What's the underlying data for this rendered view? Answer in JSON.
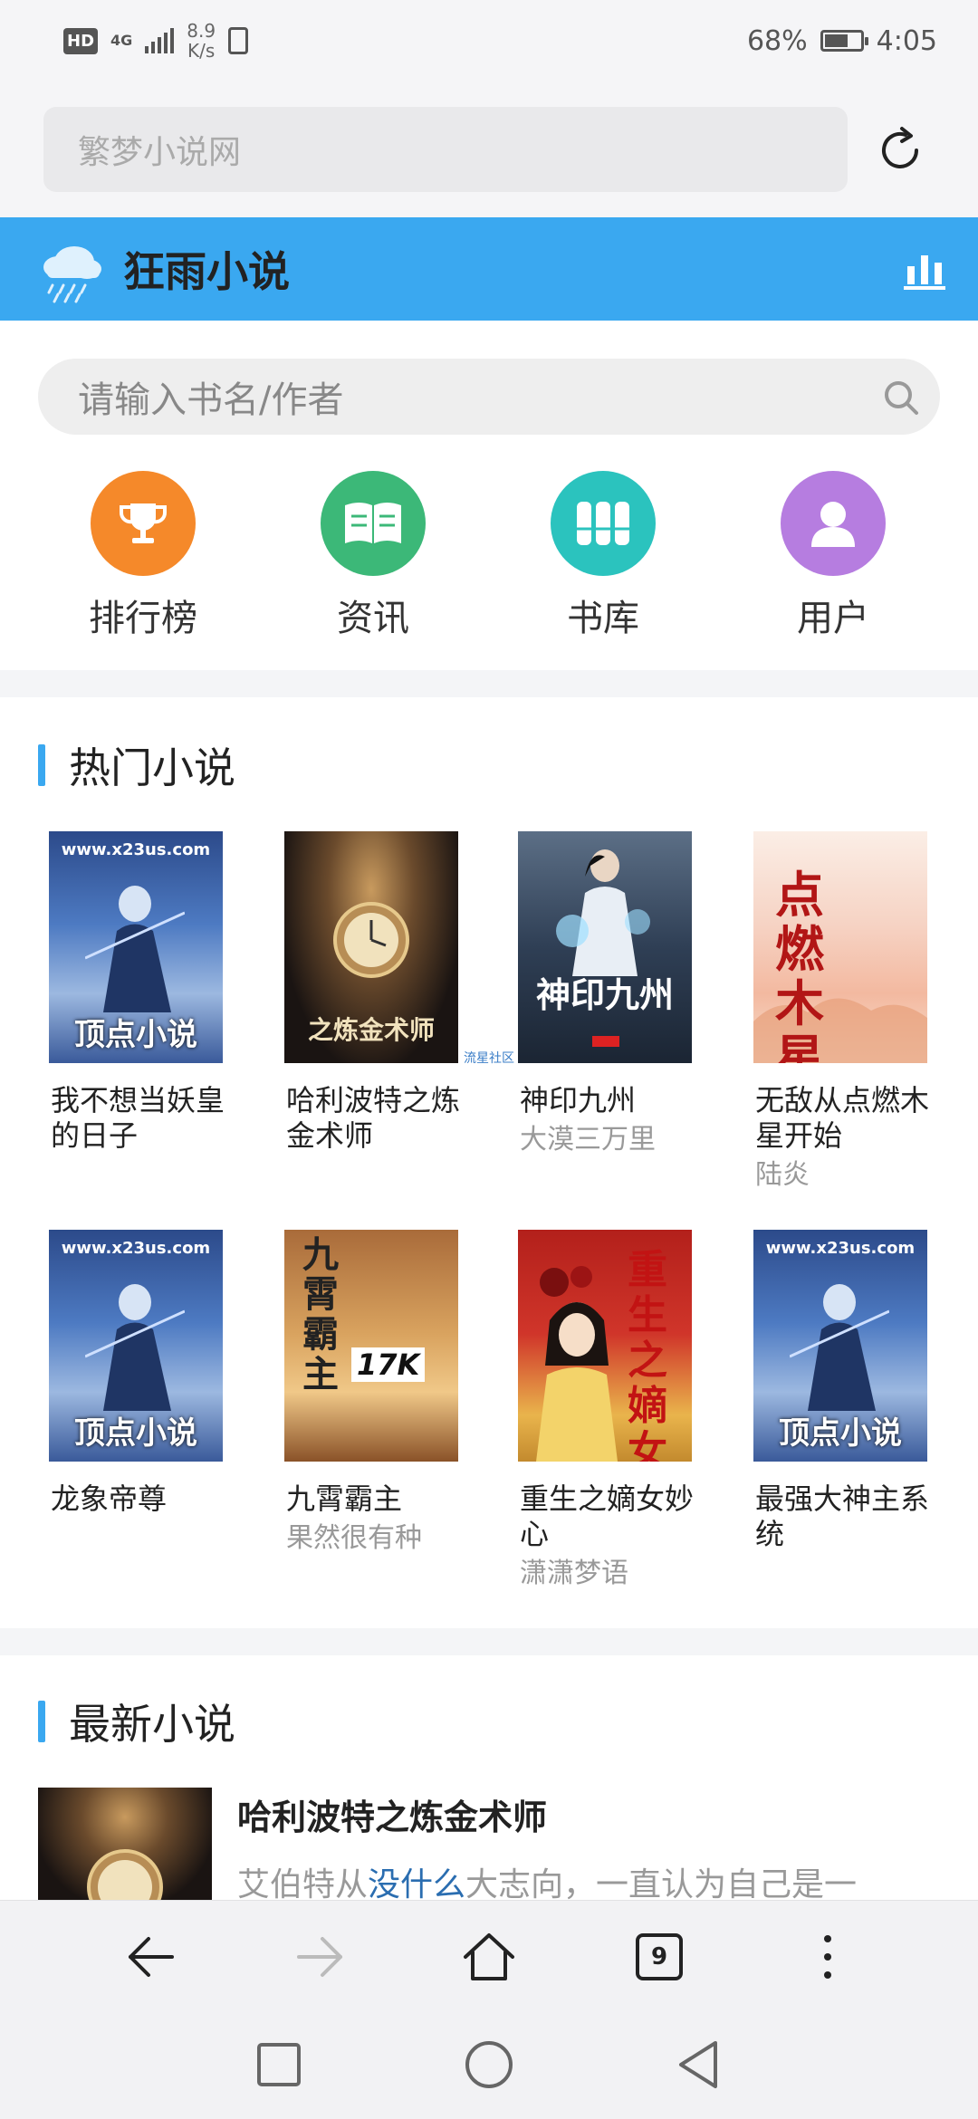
{
  "status_bar": {
    "hd": "HD",
    "network": "4G",
    "speed_value": "8.9",
    "speed_unit": "K/s",
    "battery": "68%",
    "battery_level": 0.68,
    "time": "4:05"
  },
  "browser": {
    "url_text": "繁梦小说网",
    "tab_count": "9"
  },
  "site": {
    "title": "狂雨小说",
    "accent_color": "#3aa8f0"
  },
  "search": {
    "placeholder": "请输入书名/作者"
  },
  "quick_menu": [
    {
      "label": "排行榜",
      "icon": "trophy-icon",
      "color": "#f5892a"
    },
    {
      "label": "资讯",
      "icon": "book-open-icon",
      "color": "#3cb878"
    },
    {
      "label": "书库",
      "icon": "library-icon",
      "color": "#2bc3be"
    },
    {
      "label": "用户",
      "icon": "user-icon",
      "color": "#b67de0"
    }
  ],
  "hot_section": {
    "title": "热门小说",
    "books": [
      {
        "title": "我不想当妖皇的日子",
        "author": "",
        "cover_site": "www.x23us.com",
        "cover_text": "顶点小说"
      },
      {
        "title": "哈利波特之炼金术师",
        "author": "",
        "cover_text": "之炼金术师",
        "cover_watermark": "流星社区"
      },
      {
        "title": "神印九州",
        "author": "大漠三万里",
        "cover_text": "神印九州"
      },
      {
        "title": "无敌从点燃木星开始",
        "author": "陆炎",
        "cover_text": "点燃木星"
      },
      {
        "title": "龙象帝尊",
        "author": "",
        "cover_site": "www.x23us.com",
        "cover_text": "顶点小说"
      },
      {
        "title": "九霄霸主",
        "author": "果然很有种",
        "cover_text": "九霄霸主",
        "cover_badge": "17K"
      },
      {
        "title": "重生之嫡女妙心",
        "author": "潇潇梦语",
        "cover_text": "重生之嫡女"
      },
      {
        "title": "最强大神主系统",
        "author": "",
        "cover_site": "www.x23us.com",
        "cover_text": "顶点小说"
      }
    ]
  },
  "latest_section": {
    "title": "最新小说",
    "item": {
      "title": "哈利波特之炼金术师",
      "desc_before": "艾伯特从",
      "desc_link": "没什么",
      "desc_after": "大志向，一直认为自己是一"
    }
  }
}
